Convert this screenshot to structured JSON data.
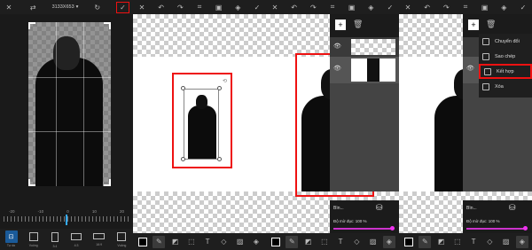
{
  "screen1": {
    "dimensions": "3133X653",
    "dropdown_caret": "▾",
    "ruler_ticks": [
      "-20",
      "-10",
      "0",
      "10",
      "20"
    ],
    "bottom_labels": [
      "Tự do",
      "Vuông",
      "3:4",
      "4:3",
      "16:9",
      "Vuông"
    ]
  },
  "screen3": {
    "blend_label": "Bìn...",
    "opacity_label": "Độ mờ đục: 100 %"
  },
  "screen4": {
    "blend_label": "Bìn...",
    "opacity_label": "Độ mờ đục: 100 %",
    "menu": [
      "Chuyển đổi",
      "Sao chép",
      "Kết hợp",
      "Xóa"
    ]
  },
  "colors": {
    "highlight": "#ee1111",
    "accent": "#cc33cc",
    "active_blue": "#1a5a99"
  },
  "icons": [
    "close-icon",
    "undo-icon",
    "redo-icon",
    "check-icon",
    "eye-icon",
    "trash-icon",
    "crop-icon",
    "video-icon",
    "layers-icon",
    "eraser-icon",
    "brush-icon",
    "text-icon",
    "image-icon"
  ]
}
